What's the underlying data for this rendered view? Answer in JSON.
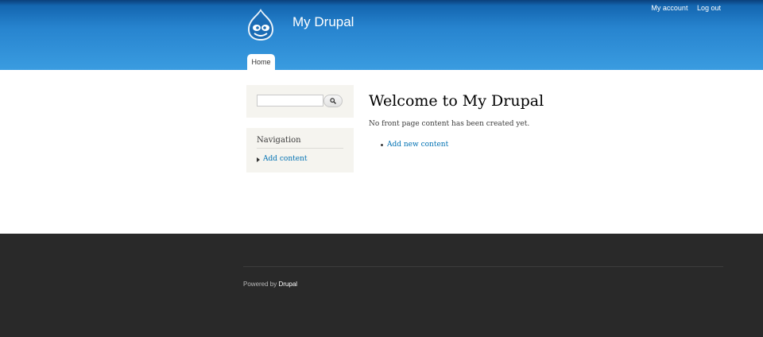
{
  "header": {
    "site_name": "My Drupal",
    "secondary_menu": [
      "My account",
      "Log out"
    ],
    "tabs": [
      {
        "label": "Home",
        "active": true
      }
    ]
  },
  "sidebar": {
    "search": {
      "value": "",
      "placeholder": "",
      "button_icon": "search-icon"
    },
    "navigation": {
      "title": "Navigation",
      "items": [
        {
          "label": "Add content",
          "icon": "triangle-bullet-icon"
        }
      ]
    }
  },
  "main": {
    "title": "Welcome to My Drupal",
    "message": "No front page content has been created yet.",
    "links": [
      {
        "label": "Add new content"
      }
    ]
  },
  "footer": {
    "powered_prefix": "Powered by",
    "powered_link": "Drupal"
  },
  "colors": {
    "header_top": "#0b3f7a",
    "header_bottom": "#3a9ce0",
    "link": "#0071b3",
    "block_bg": "#f5f4ef",
    "footer_bg": "#292929"
  }
}
